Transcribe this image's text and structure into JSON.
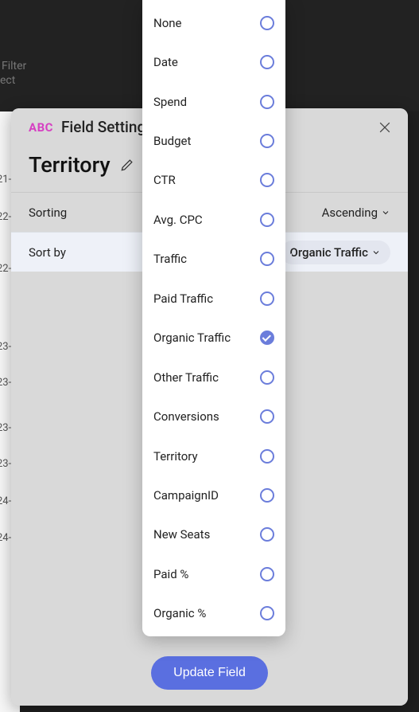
{
  "background": {
    "filter": "Filter",
    "ect": "ect",
    "col": [
      "21-",
      "22-",
      "22-",
      "23-",
      "23-",
      "23-",
      "23-",
      "24-",
      "24-"
    ]
  },
  "modal": {
    "abc": "ABC",
    "title": "Field Settings",
    "field_name": "Territory",
    "rows": {
      "sorting_label": "Sorting",
      "sorting_value": "Ascending",
      "sortby_label": "Sort by",
      "sortby_value": "Organic Traffic"
    },
    "update": "Update Field"
  },
  "options": [
    {
      "label": "None",
      "selected": false
    },
    {
      "label": "Date",
      "selected": false
    },
    {
      "label": "Spend",
      "selected": false
    },
    {
      "label": "Budget",
      "selected": false
    },
    {
      "label": "CTR",
      "selected": false
    },
    {
      "label": "Avg. CPC",
      "selected": false
    },
    {
      "label": "Traffic",
      "selected": false
    },
    {
      "label": "Paid Traffic",
      "selected": false
    },
    {
      "label": "Organic Traffic",
      "selected": true
    },
    {
      "label": "Other Traffic",
      "selected": false
    },
    {
      "label": "Conversions",
      "selected": false
    },
    {
      "label": "Territory",
      "selected": false
    },
    {
      "label": "CampaignID",
      "selected": false
    },
    {
      "label": "New Seats",
      "selected": false
    },
    {
      "label": "Paid %",
      "selected": false
    },
    {
      "label": "Organic %",
      "selected": false
    }
  ]
}
